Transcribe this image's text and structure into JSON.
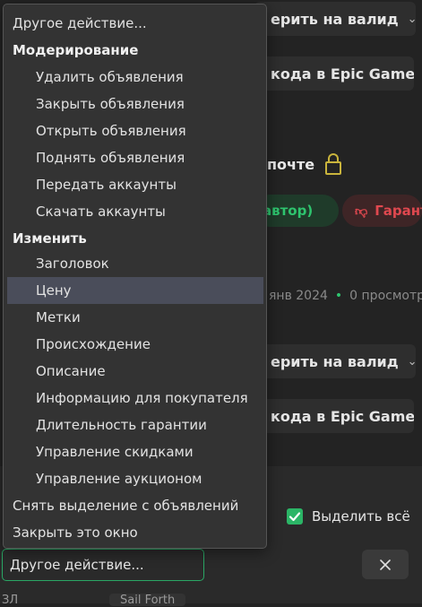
{
  "background": {
    "buttons": [
      {
        "label": "ерить на валид",
        "chevron": "chevron-down-icon"
      },
      {
        "label": "кода в Epic Games",
        "chevron": "chevron-down-icon"
      },
      {
        "label": "ерить на валид",
        "chevron": "chevron-down-icon"
      },
      {
        "label": "кода в Epic Games",
        "chevron": "chevron-down-icon"
      }
    ],
    "section_title": "почте",
    "tag_green": "автор)",
    "tag_red": "Гарант",
    "meta": {
      "date": "янв 2024",
      "views": "0 просмотр"
    },
    "select_all_label": "Выделить всё",
    "select_all_checked": true,
    "action_select_value": "Другое действие...",
    "peek_left": "ЗЛ",
    "peek_chip": "Sail Forth"
  },
  "menu": {
    "first": "Другое действие...",
    "groups": [
      {
        "title": "Модерирование",
        "items": [
          "Удалить объявления",
          "Закрыть объявления",
          "Открыть объявления",
          "Поднять объявления",
          "Передать аккаунты",
          "Скачать аккаунты"
        ]
      },
      {
        "title": "Изменить",
        "items": [
          "Заголовок",
          "Цену",
          "Метки",
          "Происхождение",
          "Описание",
          "Информацию для покупателя",
          "Длительность гарантии",
          "Управление скидками",
          "Управление аукционом"
        ]
      }
    ],
    "selected": "Цену",
    "trailing": [
      "Снять выделение с объявлений",
      "Закрыть это окно"
    ]
  },
  "colors": {
    "accent_green": "#2ec46e",
    "menu_bg": "#333333",
    "menu_highlight": "#4a4d5a",
    "danger_red": "#e0484f"
  }
}
